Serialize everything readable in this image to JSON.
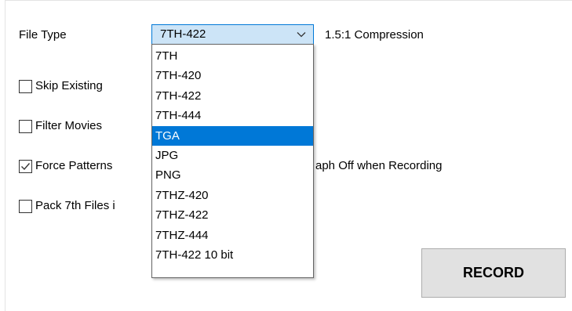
{
  "file_type": {
    "label": "File Type",
    "selected": "7TH-422",
    "compression": "1.5:1 Compression",
    "options": [
      "7TH",
      "7TH-420",
      "7TH-422",
      "7TH-444",
      "TGA",
      "JPG",
      "PNG",
      "7THZ-420",
      "7THZ-422",
      "7THZ-444",
      "7TH-422 10 bit"
    ],
    "highlighted": "TGA"
  },
  "checkboxes": {
    "skip_existing": {
      "label": "Skip Existing",
      "checked": false
    },
    "filter_movies": {
      "label": "Filter Movies",
      "checked": false
    },
    "force_patterns": {
      "label_left": "Force Patterns",
      "label_right": "aph Off when Recording",
      "checked": true
    },
    "pack_7th": {
      "label": "Pack 7th Files i",
      "checked": false
    }
  },
  "record_button": {
    "label": "RECORD"
  },
  "colors": {
    "accent": "#0078d7",
    "combo_bg": "#cce4f7",
    "button_bg": "#e1e1e1"
  },
  "icons": {
    "dropdown_arrow": "chevron-down-icon",
    "checkmark": "checkmark-icon"
  }
}
